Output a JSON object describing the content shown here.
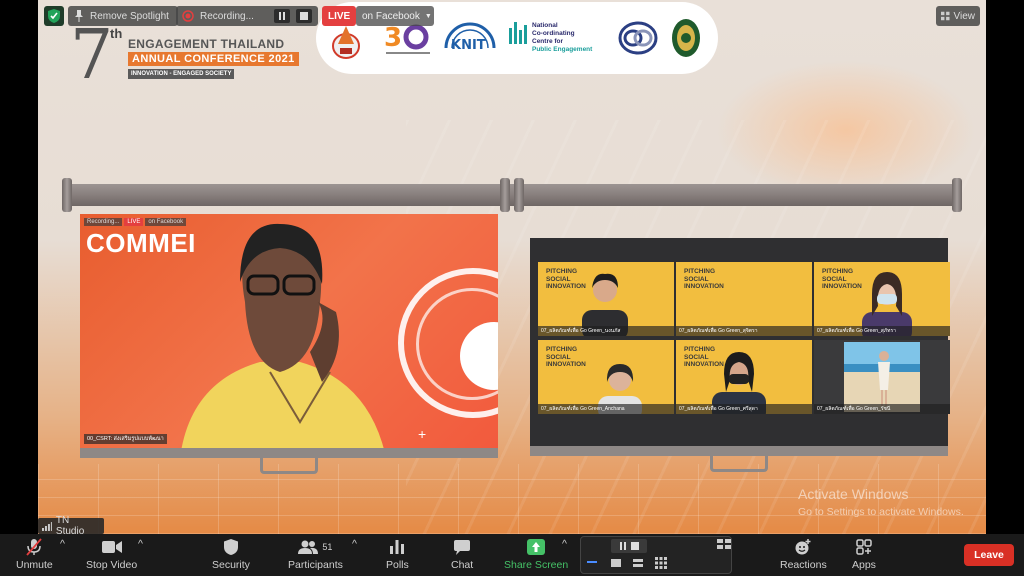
{
  "overlay": {
    "remove_spotlight": "Remove Spotlight",
    "recording": "Recording...",
    "live": "LIVE",
    "on_facebook": "on Facebook",
    "view": "View"
  },
  "conference": {
    "number": "7",
    "suffix": "th",
    "line1": "ENGAGEMENT THAILAND",
    "line2": "ANNUAL CONFERENCE 2021",
    "line3": "INNOVATION - ENGAGED SOCIETY"
  },
  "logos": {
    "knit": "KNIT",
    "ncc_line1": "National",
    "ncc_line2": "Co-ordinating",
    "ncc_line3": "Centre for",
    "ncc_line4": "Public Engagement"
  },
  "main_video": {
    "banner": "COMMEI",
    "mini_recording": "Recording...",
    "mini_live": "LIVE",
    "mini_fb": "on Facebook",
    "name": "00_CSRT: ส่งเสริมรูปแบบพัฒนา"
  },
  "gallery": {
    "tile_text": "PITCHING\nSOCIAL\nINNOVATION",
    "tiles": [
      {
        "name": "07_ผลิตภัณฑ์เพื่อ Go Green_นงนภัส"
      },
      {
        "name": "07_ผลิตภัณฑ์เพื่อ Go Green_สุจิตรา"
      },
      {
        "name": "07_ผลิตภัณฑ์เพื่อ Go Green_สุภัทรา"
      },
      {
        "name": "07_ผลิตภัณฑ์เพื่อ Go Green_Anchana"
      },
      {
        "name": "07_ผลิตภัณฑ์เพื่อ Go Green_ศรีสุดา"
      },
      {
        "name": "07_ผลิตภัณฑ์เพื่อ Go Green_รัชนี"
      }
    ]
  },
  "watermark": {
    "line1": "Activate Windows",
    "line2": "Go to Settings to activate Windows."
  },
  "tn_studio": "TN Studio",
  "toolbar": {
    "unmute": "Unmute",
    "stop_video": "Stop Video",
    "security": "Security",
    "participants": "Participants",
    "participants_count": "51",
    "polls": "Polls",
    "chat": "Chat",
    "share_screen": "Share Screen",
    "reactions": "Reactions",
    "apps": "Apps",
    "leave": "Leave"
  },
  "colors": {
    "live_red": "#e43f3f",
    "share_green": "#45c167",
    "leave_red": "#d93025",
    "tile_yellow": "#f2be3f",
    "accent_orange": "#e7782f"
  }
}
